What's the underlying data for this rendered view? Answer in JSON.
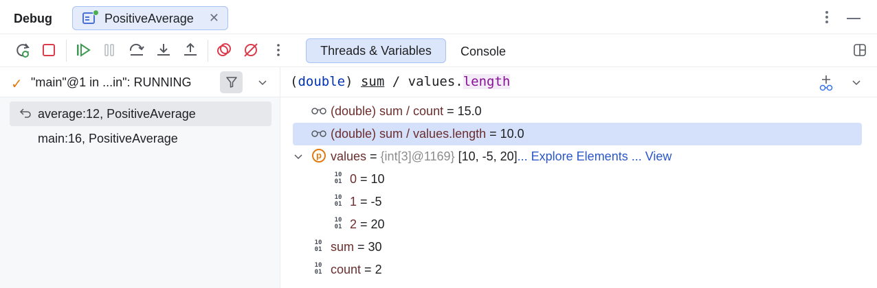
{
  "header": {
    "title": "Debug",
    "tab_label": "PositiveAverage",
    "tab_close": "✕"
  },
  "toolbar": {
    "tabs": [
      {
        "label": "Threads & Variables",
        "active": true
      },
      {
        "label": "Console",
        "active": false
      }
    ],
    "icons": [
      "rerun-icon",
      "stop-icon",
      "resume-icon",
      "pause-icon",
      "step-over-icon",
      "step-into-icon",
      "step-out-icon",
      "view-breakpoints-icon",
      "mute-breakpoints-icon",
      "more-icon"
    ]
  },
  "threads": {
    "selected_thread": "\"main\"@1 in ...in\": RUNNING",
    "frames": [
      {
        "label": "average:12, PositiveAverage",
        "selected": true
      },
      {
        "label": "main:16, PositiveAverage",
        "selected": false
      }
    ]
  },
  "expression": {
    "open_paren": "(",
    "keyword": "double",
    "close_paren": ") ",
    "sum": "sum",
    "op": " / values.",
    "field": "length"
  },
  "variables": {
    "row1": {
      "expr": "(double) sum / count",
      "eq": " = ",
      "value": "15.0"
    },
    "row2": {
      "expr": "(double) sum / values.length",
      "eq": " = ",
      "value": "10.0"
    },
    "row3": {
      "name": "values",
      "eq": " = ",
      "type": "{int[3]@1169}",
      "value": " [10, -5, 20]",
      "link1": "... Explore Elements",
      "link2": " ... View"
    },
    "row4": {
      "name": "0",
      "eq": " = ",
      "value": "10"
    },
    "row5": {
      "name": "1",
      "eq": " = ",
      "value": "-5"
    },
    "row6": {
      "name": "2",
      "eq": " = ",
      "value": "20"
    },
    "row7": {
      "name": "sum",
      "eq": " = ",
      "value": "30"
    },
    "row8": {
      "name": "count",
      "eq": " = ",
      "value": "2"
    },
    "bin_icon_top": "10",
    "bin_icon_bottom": "01",
    "param_icon": "p"
  },
  "colors": {
    "accent": "#3574f0",
    "selection": "#d5e1fa",
    "check": "#e07a10",
    "link": "#2a57c9",
    "var_name": "#6b2d2d"
  }
}
